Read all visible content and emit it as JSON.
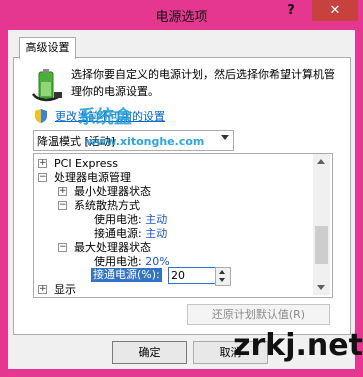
{
  "window": {
    "title": "电源选项",
    "help_label": "?",
    "close_label": "✕"
  },
  "tabs": [
    {
      "label": "高级设置"
    }
  ],
  "description": {
    "text": "选择你要自定义的电源计划，然后选择你希望计算机管理你的电源设置。"
  },
  "change_link": {
    "label": "更改当前不可用的设置"
  },
  "plan_select": {
    "value": "降温模式 [活动]"
  },
  "tree": {
    "pci_express": "PCI Express",
    "processor_mgmt": "处理器电源管理",
    "min_state": "最小处理器状态",
    "cooling_policy": "系统散热方式",
    "cooling_battery_label": "使用电池:",
    "cooling_battery_value": "主动",
    "cooling_ac_label": "接通电源:",
    "cooling_ac_value": "主动",
    "max_state": "最大处理器状态",
    "max_battery_label": "使用电池:",
    "max_battery_value": "20%",
    "max_ac_label": "接通电源(%):",
    "max_ac_value": "20",
    "display": "显示"
  },
  "buttons": {
    "restore": "还原计划默认值(R)",
    "ok": "确定",
    "cancel": "取消"
  },
  "watermarks": {
    "site_logo": "系统盒",
    "site_url": "www.xitonghe.com",
    "brand": "zrkj.net"
  },
  "colors": {
    "titlebar": "#e5378f",
    "close": "#c7423f",
    "selection": "#3373c4",
    "link": "#0066cc",
    "value": "#1a54c8"
  },
  "icons": {
    "power": "power-plan-icon",
    "shield": "uac-shield-icon"
  }
}
